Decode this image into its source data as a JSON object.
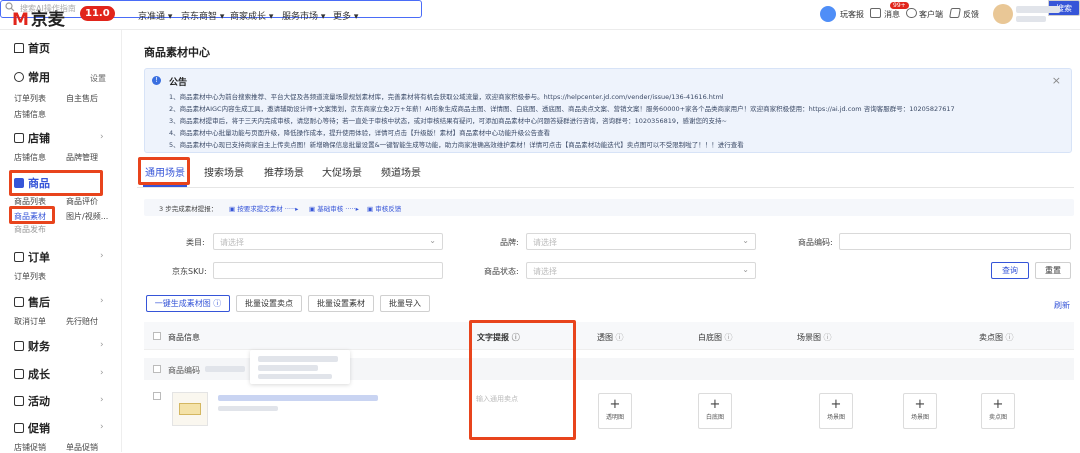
{
  "topbar": {
    "logo_mark": "M",
    "logo_text": "京麦",
    "version": "11.0",
    "nav": [
      "京准通",
      "京东商智",
      "商家成长",
      "服务市场",
      "更多"
    ],
    "search_placeholder": "搜索AI操作指南",
    "search_button": "搜索",
    "right": {
      "item1": "玩客报",
      "item2": "消息",
      "badge": "99+",
      "item3": "客户端",
      "item4": "反馈"
    }
  },
  "sidebar": {
    "home": "首页",
    "common": "常用",
    "common_settings": "设置",
    "common_items": [
      "订单列表",
      "自主售后",
      "店铺信息"
    ],
    "shop": "店铺",
    "shop_items": [
      "店铺信息",
      "品牌管理"
    ],
    "goods": "商品",
    "goods_items": [
      "商品列表",
      "商品评价",
      "商品素材",
      "图片/视频...",
      "商品发布"
    ],
    "orders": "订单",
    "orders_items": [
      "订单列表"
    ],
    "aftersale": "售后",
    "aftersale_items": [
      "取消订单",
      "先行赔付"
    ],
    "finance": "财务",
    "growth": "成长",
    "events": "活动",
    "promo": "促销",
    "promo_items": [
      "店铺促销",
      "单品促销"
    ]
  },
  "page": {
    "title": "商品素材中心"
  },
  "notice": {
    "title": "公告",
    "lines": [
      "1、商品素材中心为前台搜索推荐、平台大促及各频道流量场景规划素材库，完善素材将有机会获取公域流量，欢迎商家积极参与。https://helpcenter.jd.com/vender/issue/136-41616.html",
      "2、商品素材AIGC内容生成工具，邀请辅助设计师+文案策划，京东商家立免2万+年薪！AI形象生成商品主图、详情图、白底图、透底图、商品卖点文案、营销文案！服务60000+家各个品类商家用户！欢迎商家积极使用：https://ai.jd.com 咨询客服群号：10205827617",
      "3、商品素材提审后，将于三天内完成审核，请您耐心等待；若一直处于审核中状态，或对审核结果有疑问，可添加商品素材中心问题答疑群进行咨询，咨询群号：1020356819，感谢您的支持~",
      "4、商品素材中心批量功能与页面升级，降低操作成本，提升使用体验，详情可点击【升级版！素材】商品素材中心功能升级公告查看",
      "5、商品素材中心现已支持商家自主上传卖点图！新增确保信息批量设置&一键智能生成等功能，助力商家准确高效维护素材！详情可点击【商品素材功能迭代】卖点图可以不受限制啦了！！！进行查看"
    ]
  },
  "tabs": [
    "通用场景",
    "搜索场景",
    "推荐场景",
    "大促场景",
    "频道场景"
  ],
  "steps": {
    "prefix": "3 步完成素材提报：",
    "s1": "按要求提交素材",
    "s2": "基础审核",
    "s3": "审核反馈"
  },
  "filters": {
    "category_label": "类目:",
    "category_ph": "请选择",
    "brand_label": "品牌:",
    "brand_ph": "请选择",
    "code_label": "商品编码:",
    "sku_label": "京东SKU:",
    "status_label": "商品状态:",
    "status_ph": "请选择",
    "query": "查询",
    "reset": "重置"
  },
  "actions": {
    "gen": "一键生成素材图",
    "batch_points": "批量设置卖点",
    "batch_material": "批量设置素材",
    "batch_import": "批量导入",
    "refresh": "刷新"
  },
  "table": {
    "headers": [
      "商品信息",
      "文字提报",
      "透图",
      "白底图",
      "场景图",
      "卖点图"
    ],
    "code_label": "商品编码",
    "text_placeholder": "输入通用卖点",
    "add_labels": [
      "透明图",
      "白底图",
      "场景图",
      "场景图",
      "卖点图"
    ]
  },
  "colors": {
    "brand": "#e1251b",
    "accent": "#3655d8",
    "highlight": "#e8441c"
  }
}
